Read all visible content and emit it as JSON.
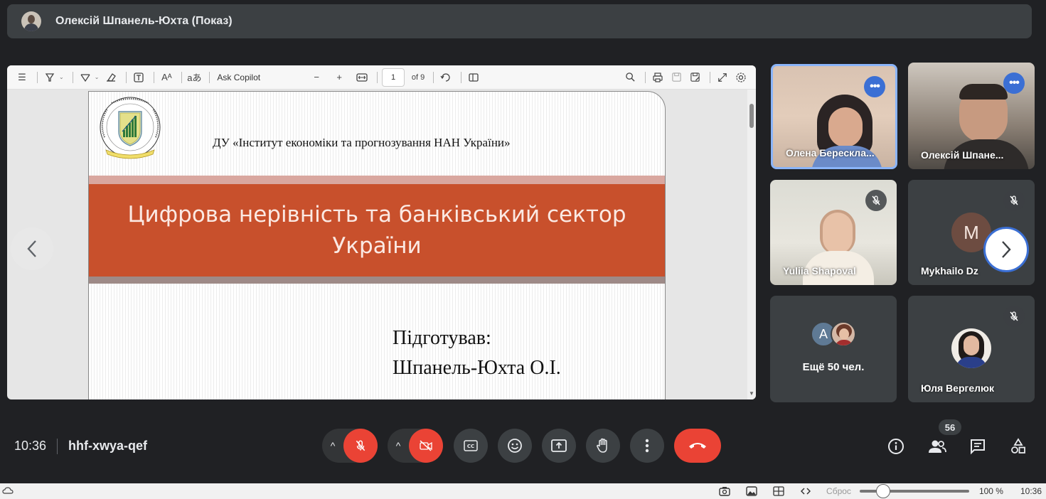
{
  "presenter": {
    "name": "Олексій Шпанель-Юхта (Показ)"
  },
  "pdf": {
    "toolbar": {
      "ask_copilot": "Ask Copilot",
      "page_current": "1",
      "page_of": "of 9",
      "aa": "aあ",
      "font_size_icon": "Aᴬ"
    },
    "slide": {
      "institute": "ДУ «Інститут економіки та прогнозування НАН України»",
      "title_line1": "Цифрова нерівність та банківський сектор",
      "title_line2": "України",
      "prepared_line1": "Підготував:",
      "prepared_line2": "Шпанель-Юхта О.І."
    }
  },
  "participants": [
    {
      "name": "Олена Берескла..."
    },
    {
      "name": "Олексій Шпане..."
    },
    {
      "name": "Yuliia Shapoval"
    },
    {
      "name": "Mykhailo Dz",
      "initial": "M"
    },
    {
      "name": "Ещё 50 чел.",
      "initial": "A"
    },
    {
      "name": "Юля Вергелюк"
    }
  ],
  "bottom": {
    "time": "10:36",
    "meeting_code": "hhf-xwya-qef",
    "participants_count": "56"
  },
  "statusbar": {
    "reset": "Сброс",
    "zoom": "100 %",
    "time": "10:36"
  },
  "colors": {
    "accent": "#3b6fd4",
    "end_call": "#ea4335",
    "slide_title_band": "#c8502c"
  }
}
